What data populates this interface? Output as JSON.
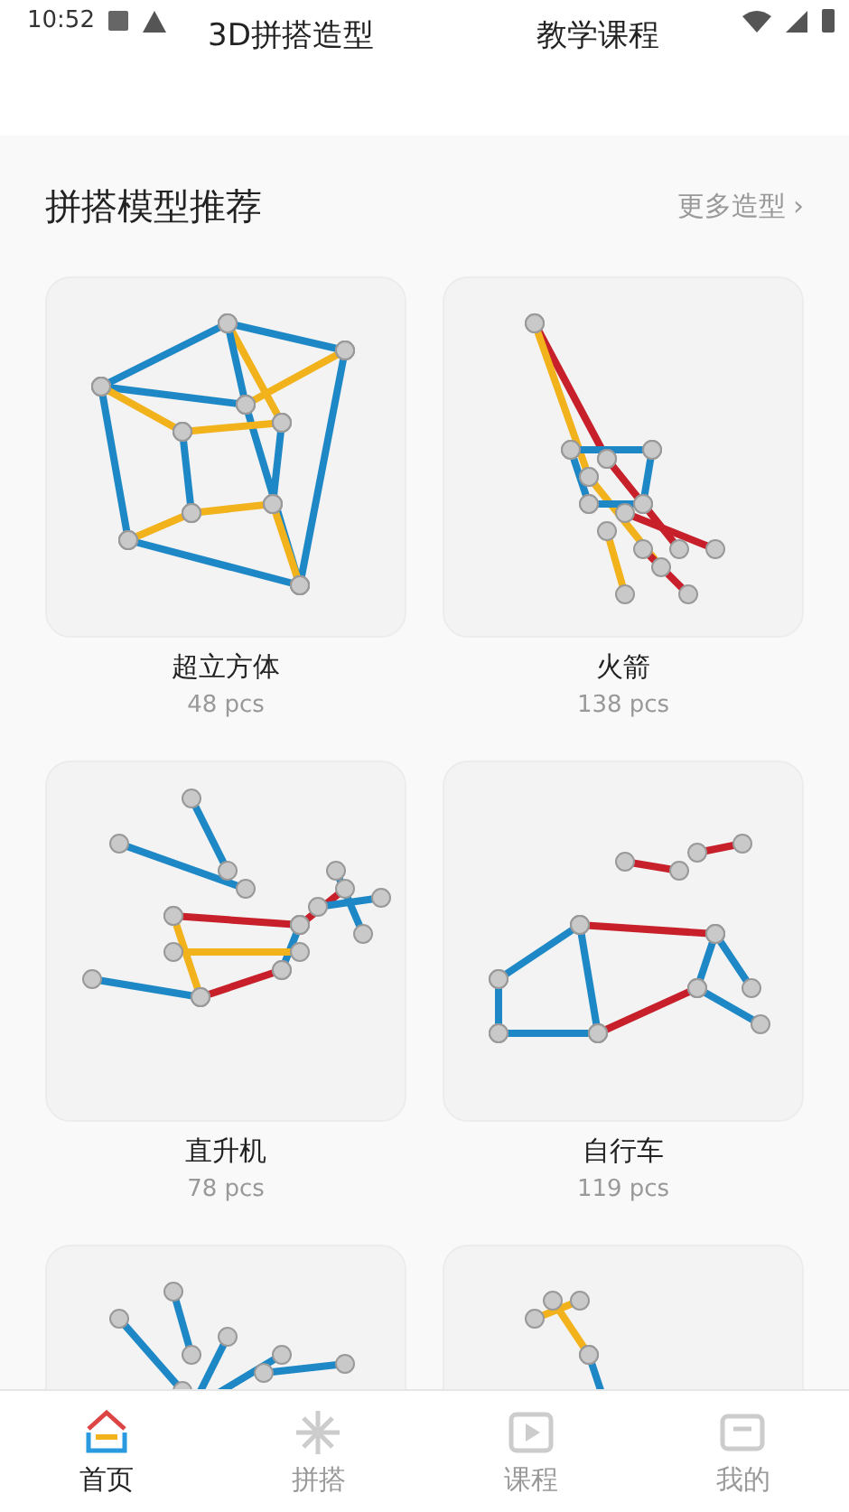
{
  "status_bar": {
    "time": "10:52"
  },
  "header_tabs": [
    {
      "label": "3D拼搭造型"
    },
    {
      "label": "教学课程"
    }
  ],
  "section": {
    "title": "拼搭模型推荐",
    "more": "更多造型",
    "more_arrow": "›"
  },
  "models": [
    {
      "name": "超立方体",
      "count": "48 pcs",
      "kind": "cube"
    },
    {
      "name": "火箭",
      "count": "138 pcs",
      "kind": "rocket"
    },
    {
      "name": "直升机",
      "count": "78 pcs",
      "kind": "helicopter"
    },
    {
      "name": "自行车",
      "count": "119 pcs",
      "kind": "bicycle"
    },
    {
      "kind": "tree"
    },
    {
      "kind": "giraffe"
    }
  ],
  "tab_bar": [
    {
      "label": "首页",
      "selected": true
    },
    {
      "label": "拼搭",
      "selected": false
    },
    {
      "label": "课程",
      "selected": false
    },
    {
      "label": "我的",
      "selected": false
    }
  ]
}
